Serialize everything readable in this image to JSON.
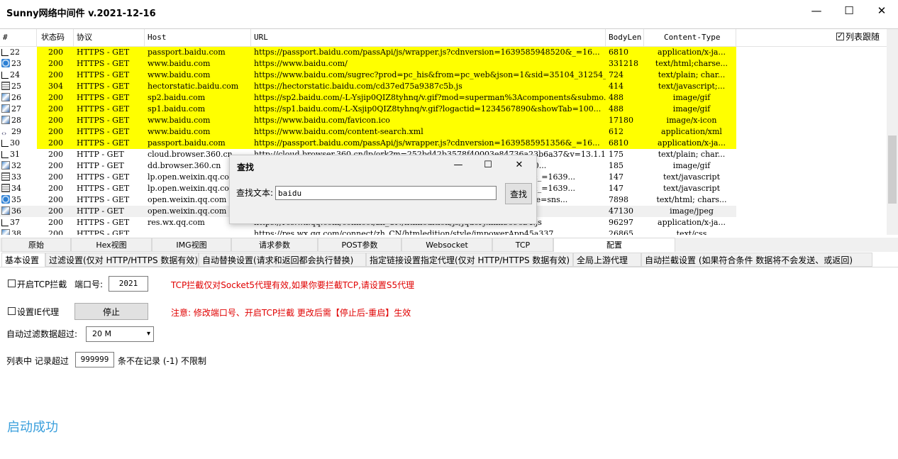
{
  "app": {
    "title": "Sunny网络中间件 v.2021-12-16",
    "min_glyph": "—",
    "max_glyph": "☐",
    "close_glyph": "✕"
  },
  "grid": {
    "columns": [
      "#",
      "状态码",
      "协议",
      "Host",
      "URL",
      "BodyLen",
      "Content-Type"
    ],
    "follow_label": "列表跟随",
    "follow_checked": true,
    "rows": [
      {
        "num": "22",
        "status": "200",
        "proto": "HTTPS - GET",
        "host": "passport.baidu.com",
        "url": "https://passport.baidu.com/passApi/js/wrapper.js?cdnversion=1639585948520&_=16...",
        "len": "6810",
        "ctype": "application/x-ja...",
        "hl": true,
        "icon": "doc"
      },
      {
        "num": "23",
        "status": "200",
        "proto": "HTTPS - GET",
        "host": "www.baidu.com",
        "url": "https://www.baidu.com/",
        "len": "331218",
        "ctype": "text/html;charse...",
        "hl": true,
        "icon": "net"
      },
      {
        "num": "24",
        "status": "200",
        "proto": "HTTPS - GET",
        "host": "www.baidu.com",
        "url": "https://www.baidu.com/sugrec?prod=pc_his&from=pc_web&json=1&sid=35104_31254_35...",
        "len": "724",
        "ctype": "text/plain; char...",
        "hl": true,
        "icon": "doc"
      },
      {
        "num": "25",
        "status": "304",
        "proto": "HTTPS - GET",
        "host": "hectorstatic.baidu.com",
        "url": "https://hectorstatic.baidu.com/cd37ed75a9387c5b.js",
        "len": "414",
        "ctype": "text/javascript;...",
        "hl": true,
        "icon": "js"
      },
      {
        "num": "26",
        "status": "200",
        "proto": "HTTPS - GET",
        "host": "sp2.baidu.com",
        "url": "https://sp2.baidu.com/-L-Ysjip0QIZ8tyhnq/v.gif?mod=superman%3Acomponents&submo...",
        "len": "488",
        "ctype": "image/gif",
        "hl": true,
        "icon": "img"
      },
      {
        "num": "27",
        "status": "200",
        "proto": "HTTPS - GET",
        "host": "sp1.baidu.com",
        "url": "https://sp1.baidu.com/-L-Xsjip0QIZ8tyhnq/v.gif?logactid=1234567890&showTab=100...",
        "len": "488",
        "ctype": "image/gif",
        "hl": true,
        "icon": "img"
      },
      {
        "num": "28",
        "status": "200",
        "proto": "HTTPS - GET",
        "host": "www.baidu.com",
        "url": "https://www.baidu.com/favicon.ico",
        "len": "17180",
        "ctype": "image/x-icon",
        "hl": true,
        "icon": "img"
      },
      {
        "num": "29",
        "status": "200",
        "proto": "HTTPS - GET",
        "host": "www.baidu.com",
        "url": "https://www.baidu.com/content-search.xml",
        "len": "612",
        "ctype": "application/xml",
        "hl": true,
        "icon": "xml"
      },
      {
        "num": "30",
        "status": "200",
        "proto": "HTTPS - GET",
        "host": "passport.baidu.com",
        "url": "https://passport.baidu.com/passApi/js/wrapper.js?cdnversion=1639585951356&_=16...",
        "len": "6810",
        "ctype": "application/x-ja...",
        "hl": true,
        "icon": "doc"
      },
      {
        "num": "31",
        "status": "200",
        "proto": "HTTP - GET",
        "host": "cloud.browser.360.cn",
        "url": "http://cloud.browser.360.cn/lp/ork?m=252bd42b3578f40003e84736a23b6a37&v=13.1.1...",
        "len": "175",
        "ctype": "text/plain; char...",
        "hl": false,
        "icon": "doc"
      },
      {
        "num": "32",
        "status": "200",
        "proto": "HTTP - GET",
        "host": "dd.browser.360.cn",
        "url": "http://dd.browser.360.cn/static/a/868.7891.gif?mid=252bd42b3578f400...",
        "len": "185",
        "ctype": "image/gif",
        "hl": false,
        "icon": "img"
      },
      {
        "num": "33",
        "status": "200",
        "proto": "HTTPS - GET",
        "host": "lp.open.weixin.qq.com",
        "url": "https://lp.open.weixin.qq.com/connect/l/qrconnect?uuid=031aa7000V&_=1639...",
        "len": "147",
        "ctype": "text/javascript",
        "hl": false,
        "icon": "js"
      },
      {
        "num": "34",
        "status": "200",
        "proto": "HTTPS - GET",
        "host": "lp.open.weixin.qq.com",
        "url": "https://lp.open.weixin.qq.com/connect/l/qrconnect?uuid=031aa7000V&_=1639...",
        "len": "147",
        "ctype": "text/javascript",
        "hl": false,
        "icon": "js"
      },
      {
        "num": "35",
        "status": "200",
        "proto": "HTTPS - GET",
        "host": "open.weixin.qq.com",
        "url": "https://open.weixin.qq.com/connect/qrconnect?appid=wx85a2bd&scope=sns...",
        "len": "7898",
        "ctype": "text/html; chars...",
        "hl": false,
        "icon": "net"
      },
      {
        "num": "36",
        "status": "200",
        "proto": "HTTP - GET",
        "host": "open.weixin.qq.com",
        "url": "https://open.weixin.qq.com/connect/qrcode/031aa7000V",
        "len": "47130",
        "ctype": "image/jpeg",
        "hl": false,
        "icon": "img",
        "sel": true
      },
      {
        "num": "37",
        "status": "200",
        "proto": "HTTPS - GET",
        "host": "res.wx.qq.com",
        "url": "https://res.wx.qq.com/connect/zh_CN/htmledition/js/jquery.min3696b4.js",
        "len": "96297",
        "ctype": "application/x-ja...",
        "hl": false,
        "icon": "doc"
      },
      {
        "num": "38",
        "status": "200",
        "proto": "HTTPS - GET",
        "host": "",
        "url": "https://res.wx.qq.com/connect/zh_CN/htmledition/style/impowerApp45a337...",
        "len": "26865",
        "ctype": "text/css",
        "hl": false,
        "icon": "img"
      }
    ]
  },
  "find_dialog": {
    "title": "查找",
    "label": "查找文本:",
    "value": "baidu",
    "button": "查找",
    "min_glyph": "—",
    "max_glyph": "☐",
    "close_glyph": "✕"
  },
  "tabs_top": [
    "原始",
    "Hex视图",
    "IMG视图",
    "请求参数",
    "POST参数",
    "Websocket",
    "TCP",
    "配置"
  ],
  "tabs_sub": [
    "基本设置",
    "过滤设置(仅对 HTTP/HTTPS 数据有效)",
    "自动替换设置(请求和返回都会执行替换)",
    "指定链接设置指定代理(仅对 HTTP/HTTPS 数据有效)",
    "全局上游代理",
    "自动拦截设置 (如果符合条件 数据将不会发送、或返回)"
  ],
  "settings": {
    "tcp_intercept_label": "开启TCP拦截",
    "port_label": "端口号:",
    "port_value": "2021",
    "tcp_note": "TCP拦截仅对Socket5代理有效,如果你要拦截TCP,请设置S5代理",
    "ie_proxy_label": "设置IE代理",
    "stop_button": "停止",
    "notice": "注意: 修改端口号、开启TCP拦截 更改后需【停止后-重启】生效",
    "auto_filter_label": "自动过滤数据超过:",
    "auto_filter_value": "20 M",
    "record_label_a": "列表中 记录超过",
    "record_value": "999999",
    "record_label_b": "条不在记录 (-1) 不限制",
    "status": "启动成功"
  }
}
